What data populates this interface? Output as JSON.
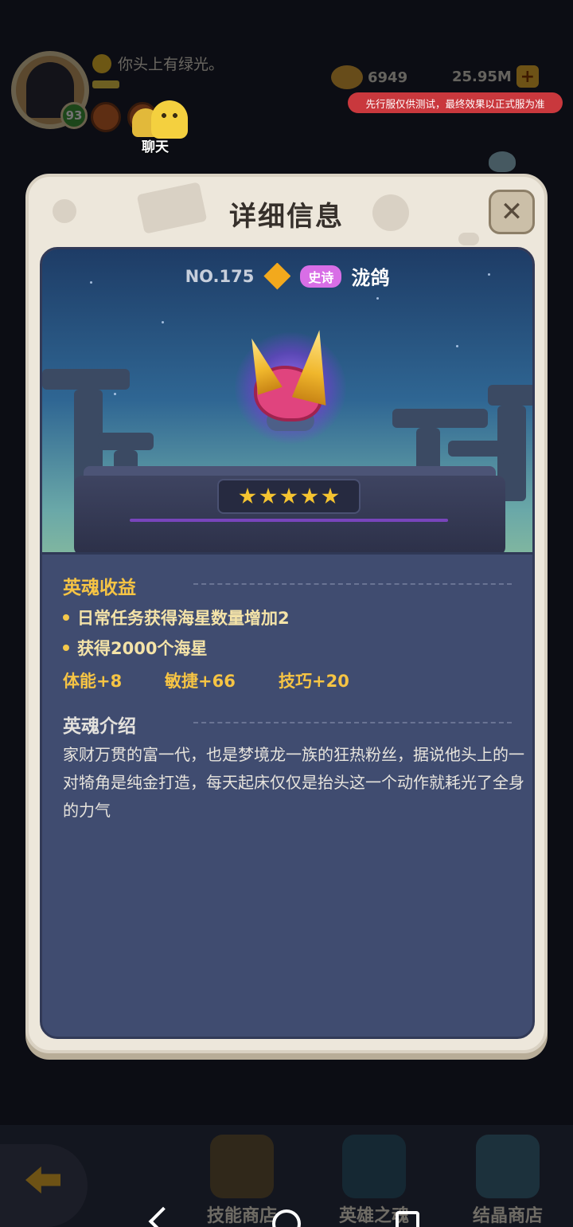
{
  "background": {
    "level": "93",
    "chat_message": "你头上有绿光。",
    "chat_label": "聊天",
    "coins": "6949",
    "shells": "25.95M",
    "plus_label": "+",
    "notice": "先行服仅供测试，最终效果以正式服为准",
    "nav": [
      {
        "label": "技能商店"
      },
      {
        "label": "英雄之魂"
      },
      {
        "label": "结晶商店"
      }
    ]
  },
  "modal": {
    "title": "详细信息",
    "close_label": "✕",
    "hero": {
      "number": "NO.175",
      "rarity": "史诗",
      "name": "泷鸽",
      "stars": 5
    },
    "benefits": {
      "title": "英魂收益",
      "items": [
        "日常任务获得海星数量增加2",
        "获得2000个海星"
      ],
      "stats": [
        "体能+8",
        "敏捷+66",
        "技巧+20"
      ]
    },
    "intro": {
      "title": "英魂介绍",
      "text": "家财万贯的富一代，也是梦境龙一族的狂热粉丝，据说他头上的一对犄角是纯金打造，每天起床仅仅是抬头这一个动作就耗光了全身的力气"
    }
  },
  "colors": {
    "gold": "#f6c444",
    "epic_purple": "#d86ee6",
    "panel_blue": "#404c70",
    "modal_bg": "#ede7db"
  }
}
